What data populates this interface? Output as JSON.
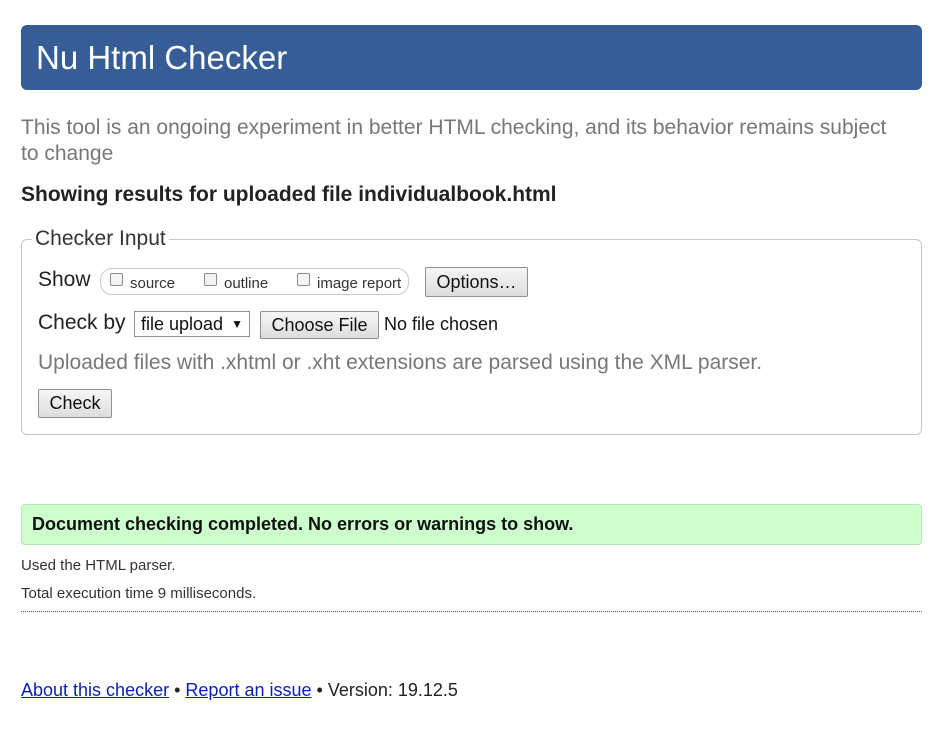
{
  "header": {
    "title": "Nu Html Checker"
  },
  "intro": {
    "text": "This tool is an ongoing experiment in better HTML checking, and its behavior remains subject to change"
  },
  "results_heading": "Showing results for uploaded file individualbook.html",
  "checker_input": {
    "legend": "Checker Input",
    "show_label": "Show",
    "checkboxes": [
      {
        "label": "source",
        "checked": false
      },
      {
        "label": "outline",
        "checked": false
      },
      {
        "label": "image report",
        "checked": false
      }
    ],
    "options_button": "Options…",
    "check_by_label": "Check by",
    "check_by_selected": "file upload",
    "choose_file_button": "Choose File",
    "no_file_text": "No file chosen",
    "xml_note": "Uploaded files with .xhtml or .xht extensions are parsed using the XML parser.",
    "check_button": "Check"
  },
  "result": {
    "success_message": "Document checking completed. No errors or warnings to show.",
    "parser_note": "Used the HTML parser.",
    "execution_time": "Total execution time 9 milliseconds."
  },
  "footer": {
    "about_link": "About this checker",
    "separator": "•",
    "report_link": "Report an issue",
    "version_text": "Version: 19.12.5"
  },
  "colors": {
    "header_bg": "#365d95",
    "success_bg": "#ccffcc",
    "link": "#0a1eb4",
    "muted_text": "#777777"
  }
}
